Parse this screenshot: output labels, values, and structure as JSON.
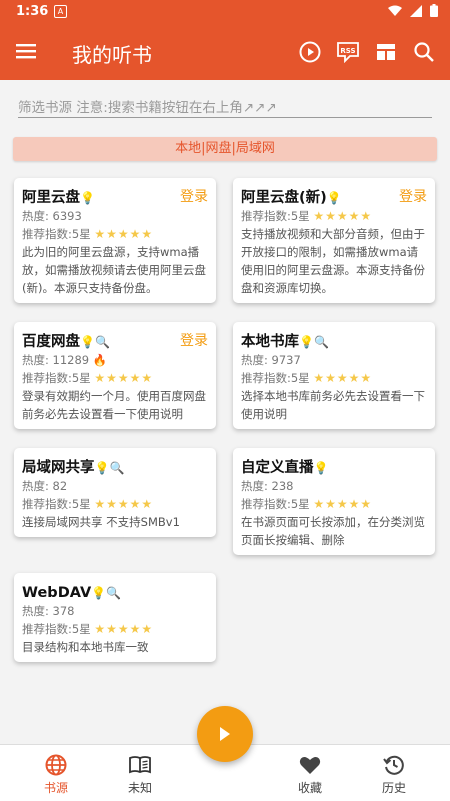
{
  "status": {
    "time": "1:36",
    "notif": "A"
  },
  "appbar": {
    "title": "我的听书"
  },
  "filter": {
    "placeholder": "筛选书源 注意:搜索书籍按钮在右上角↗↗↗"
  },
  "banner": {
    "text": "本地|网盘|局域网"
  },
  "cards": [
    {
      "name": "阿里云盘",
      "action": "登录",
      "heat": "热度: 6393",
      "rating_label": "推荐指数:5星",
      "stars": 5,
      "desc": "此为旧的阿里云盘源，支持wma播放，如需播放视频请去使用阿里云盘(新)。本源只支持备份盘。"
    },
    {
      "name": "阿里云盘(新)",
      "action": "登录",
      "rating_label": "推荐指数:5星",
      "stars": 5,
      "desc": "支持播放视频和大部分音频，但由于开放接口的限制，如需播放wma请使用旧的阿里云盘源。本源支持备份盘和资源库切换。"
    },
    {
      "name": "百度网盘",
      "action": "登录",
      "heat": "热度: 11289",
      "rating_label": "推荐指数:5星",
      "stars": 5,
      "desc": "登录有效期约一个月。使用百度网盘前务必先去设置看一下使用说明"
    },
    {
      "name": "本地书库",
      "heat": "热度: 9737",
      "rating_label": "推荐指数:5星",
      "stars": 5,
      "desc": "选择本地书库前务必先去设置看一下使用说明"
    },
    {
      "name": "局域网共享",
      "heat": "热度: 82",
      "rating_label": "推荐指数:5星",
      "stars": 5,
      "desc": "连接局域网共享 不支持SMBv1"
    },
    {
      "name": "自定义直播",
      "heat": "热度: 238",
      "rating_label": "推荐指数:5星",
      "stars": 5,
      "desc": "在书源页面可长按添加，在分类浏览页面长按编辑、删除"
    },
    {
      "name": "WebDAV",
      "heat": "热度: 378",
      "rating_label": "推荐指数:5星",
      "stars": 5,
      "desc": "目录结构和本地书库一致"
    }
  ],
  "nav": [
    {
      "label": "书源"
    },
    {
      "label": "未知"
    },
    {
      "label": "收藏"
    },
    {
      "label": "历史"
    }
  ],
  "colors": {
    "primary": "#e5552c",
    "accent": "#f39c12",
    "star": "#f5c84a"
  }
}
